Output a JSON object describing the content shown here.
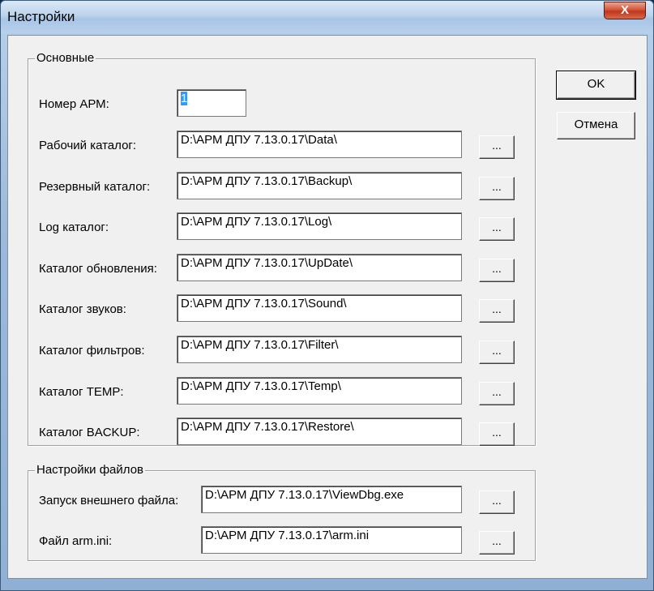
{
  "window": {
    "title": "Настройки",
    "close_label": "X"
  },
  "buttons": {
    "ok": "OK",
    "cancel": "Отмена"
  },
  "basic": {
    "legend": "Основные",
    "arm_number_label": "Номер АРМ:",
    "arm_number_value": "1",
    "rows": [
      {
        "label": "Рабочий каталог:",
        "value": "D:\\АРМ ДПУ 7.13.0.17\\Data\\",
        "browse": "..."
      },
      {
        "label": "Резервный каталог:",
        "value": "D:\\АРМ ДПУ 7.13.0.17\\Backup\\",
        "browse": "..."
      },
      {
        "label": "Log каталог:",
        "value": "D:\\АРМ ДПУ 7.13.0.17\\Log\\",
        "browse": "..."
      },
      {
        "label": "Каталог обновления:",
        "value": "D:\\АРМ ДПУ 7.13.0.17\\UpDate\\",
        "browse": "..."
      },
      {
        "label": "Каталог звуков:",
        "value": "D:\\АРМ ДПУ 7.13.0.17\\Sound\\",
        "browse": "..."
      },
      {
        "label": "Каталог фильтров:",
        "value": "D:\\АРМ ДПУ 7.13.0.17\\Filter\\",
        "browse": "..."
      },
      {
        "label": "Каталог TEMP:",
        "value": "D:\\АРМ ДПУ 7.13.0.17\\Temp\\",
        "browse": "..."
      },
      {
        "label": "Каталог BACKUP:",
        "value": "D:\\АРМ ДПУ 7.13.0.17\\Restore\\",
        "browse": "..."
      }
    ]
  },
  "files": {
    "legend": "Настройки файлов",
    "rows": [
      {
        "label": "Запуск внешнего файла:",
        "value": "D:\\АРМ ДПУ 7.13.0.17\\ViewDbg.exe",
        "browse": "..."
      },
      {
        "label": "Файл arm.ini:",
        "value": "D:\\АРМ ДПУ 7.13.0.17\\arm.ini",
        "browse": "..."
      }
    ]
  }
}
